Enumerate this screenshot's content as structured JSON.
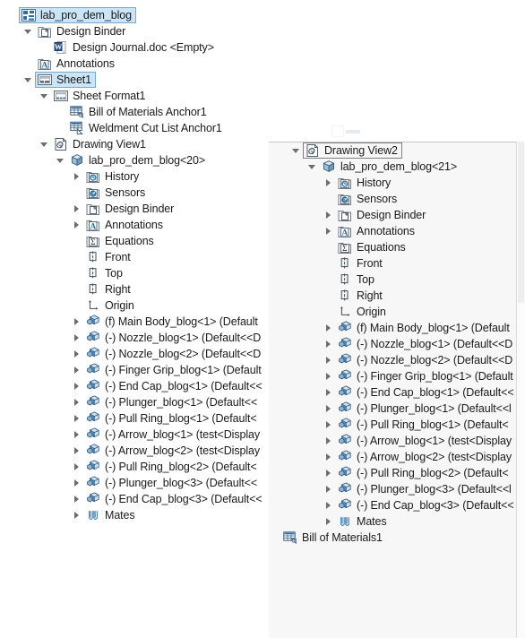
{
  "app": {
    "title": "SolidWorks Drawing FeatureManager Design Tree",
    "selection_color": "#cce4f7",
    "selection_border_color": "#7aa7cc",
    "focus_border_color": "#7d7d7d",
    "panel_background": "#f7f7f7",
    "text_color": "#1a1a1a"
  },
  "left_tree": {
    "panel_name": "drawing-feature-tree",
    "nodes": [
      {
        "label": "lab_pro_dem_blog",
        "icon": "drawing-document-icon",
        "depth": 0,
        "twisty": "none",
        "state": "selected"
      },
      {
        "label": "Design Binder",
        "icon": "design-binder-folder-icon",
        "depth": 1,
        "twisty": "expanded",
        "state": "normal"
      },
      {
        "label": "Design Journal.doc <Empty>",
        "icon": "word-document-icon",
        "depth": 2,
        "twisty": "none",
        "state": "normal"
      },
      {
        "label": "Annotations",
        "icon": "annotations-folder-icon",
        "depth": 1,
        "twisty": "none",
        "state": "normal"
      },
      {
        "label": "Sheet1",
        "icon": "sheet-icon",
        "depth": 1,
        "twisty": "expanded",
        "state": "selected"
      },
      {
        "label": "Sheet Format1",
        "icon": "sheet-format-icon",
        "depth": 2,
        "twisty": "expanded",
        "state": "normal"
      },
      {
        "label": "Bill of Materials Anchor1",
        "icon": "bom-anchor-icon",
        "depth": 3,
        "twisty": "none",
        "state": "normal"
      },
      {
        "label": "Weldment Cut List Anchor1",
        "icon": "weldment-cut-list-anchor-icon",
        "depth": 3,
        "twisty": "none",
        "state": "normal"
      },
      {
        "label": "Drawing View1",
        "icon": "drawing-view-icon",
        "depth": 2,
        "twisty": "expanded",
        "state": "normal"
      },
      {
        "label": "lab_pro_dem_blog<20>",
        "icon": "assembly-icon",
        "depth": 3,
        "twisty": "expanded",
        "state": "normal"
      },
      {
        "label": "History",
        "icon": "history-folder-icon",
        "depth": 4,
        "twisty": "collapsed",
        "state": "normal"
      },
      {
        "label": "Sensors",
        "icon": "sensors-folder-icon",
        "depth": 4,
        "twisty": "none",
        "state": "normal"
      },
      {
        "label": "Design Binder",
        "icon": "design-binder-folder-icon",
        "depth": 4,
        "twisty": "collapsed",
        "state": "normal"
      },
      {
        "label": "Annotations",
        "icon": "annotations-folder-icon",
        "depth": 4,
        "twisty": "collapsed",
        "state": "normal"
      },
      {
        "label": "Equations",
        "icon": "equations-folder-icon",
        "depth": 4,
        "twisty": "none",
        "state": "normal"
      },
      {
        "label": "Front",
        "icon": "plane-icon",
        "depth": 4,
        "twisty": "none",
        "state": "normal"
      },
      {
        "label": "Top",
        "icon": "plane-icon",
        "depth": 4,
        "twisty": "none",
        "state": "normal"
      },
      {
        "label": "Right",
        "icon": "plane-icon",
        "depth": 4,
        "twisty": "none",
        "state": "normal"
      },
      {
        "label": "Origin",
        "icon": "origin-icon",
        "depth": 4,
        "twisty": "none",
        "state": "normal"
      },
      {
        "label": "(f) Main Body_blog<1> (Default",
        "icon": "part-component-icon",
        "depth": 4,
        "twisty": "collapsed",
        "state": "normal"
      },
      {
        "label": "(-) Nozzle_blog<1> (Default<<D",
        "icon": "part-component-icon",
        "depth": 4,
        "twisty": "collapsed",
        "state": "normal"
      },
      {
        "label": "(-) Nozzle_blog<2> (Default<<D",
        "icon": "part-component-icon",
        "depth": 4,
        "twisty": "collapsed",
        "state": "normal"
      },
      {
        "label": "(-) Finger Grip_blog<1> (Default",
        "icon": "part-component-icon",
        "depth": 4,
        "twisty": "collapsed",
        "state": "normal"
      },
      {
        "label": "(-) End Cap_blog<1> (Default<<",
        "icon": "part-component-icon",
        "depth": 4,
        "twisty": "collapsed",
        "state": "normal"
      },
      {
        "label": "(-) Plunger_blog<1> (Default<<",
        "icon": "part-component-icon",
        "depth": 4,
        "twisty": "collapsed",
        "state": "normal"
      },
      {
        "label": "(-) Pull Ring_blog<1> (Default<",
        "icon": "part-component-icon",
        "depth": 4,
        "twisty": "collapsed",
        "state": "normal"
      },
      {
        "label": "(-) Arrow_blog<1> (test<Display",
        "icon": "part-component-icon",
        "depth": 4,
        "twisty": "collapsed",
        "state": "normal"
      },
      {
        "label": "(-) Arrow_blog<2> (test<Display",
        "icon": "part-component-icon",
        "depth": 4,
        "twisty": "collapsed",
        "state": "normal"
      },
      {
        "label": "(-) Pull Ring_blog<2> (Default<",
        "icon": "part-component-icon",
        "depth": 4,
        "twisty": "collapsed",
        "state": "normal"
      },
      {
        "label": "(-) Plunger_blog<3> (Default<<",
        "icon": "part-component-icon",
        "depth": 4,
        "twisty": "collapsed",
        "state": "normal"
      },
      {
        "label": "(-) End Cap_blog<3> (Default<<",
        "icon": "part-component-icon",
        "depth": 4,
        "twisty": "collapsed",
        "state": "normal"
      },
      {
        "label": "Mates",
        "icon": "mates-icon",
        "depth": 4,
        "twisty": "collapsed",
        "state": "normal"
      }
    ]
  },
  "right_tree": {
    "panel_name": "drawing-view2-feature-tree",
    "nodes": [
      {
        "label": "Drawing View2",
        "icon": "drawing-view-icon",
        "depth": 0,
        "twisty": "expanded",
        "state": "focused"
      },
      {
        "label": "lab_pro_dem_blog<21>",
        "icon": "assembly-icon",
        "depth": 1,
        "twisty": "expanded",
        "state": "normal"
      },
      {
        "label": "History",
        "icon": "history-folder-icon",
        "depth": 2,
        "twisty": "collapsed",
        "state": "normal"
      },
      {
        "label": "Sensors",
        "icon": "sensors-folder-icon",
        "depth": 2,
        "twisty": "none",
        "state": "normal"
      },
      {
        "label": "Design Binder",
        "icon": "design-binder-folder-icon",
        "depth": 2,
        "twisty": "collapsed",
        "state": "normal"
      },
      {
        "label": "Annotations",
        "icon": "annotations-folder-icon",
        "depth": 2,
        "twisty": "collapsed",
        "state": "normal"
      },
      {
        "label": "Equations",
        "icon": "equations-folder-icon",
        "depth": 2,
        "twisty": "none",
        "state": "normal"
      },
      {
        "label": "Front",
        "icon": "plane-icon",
        "depth": 2,
        "twisty": "none",
        "state": "normal"
      },
      {
        "label": "Top",
        "icon": "plane-icon",
        "depth": 2,
        "twisty": "none",
        "state": "normal"
      },
      {
        "label": "Right",
        "icon": "plane-icon",
        "depth": 2,
        "twisty": "none",
        "state": "normal"
      },
      {
        "label": "Origin",
        "icon": "origin-icon",
        "depth": 2,
        "twisty": "none",
        "state": "normal"
      },
      {
        "label": "(f) Main Body_blog<1> (Default",
        "icon": "part-component-icon",
        "depth": 2,
        "twisty": "collapsed",
        "state": "normal"
      },
      {
        "label": "(-) Nozzle_blog<1> (Default<<D",
        "icon": "part-component-icon",
        "depth": 2,
        "twisty": "collapsed",
        "state": "normal"
      },
      {
        "label": "(-) Nozzle_blog<2> (Default<<D",
        "icon": "part-component-icon",
        "depth": 2,
        "twisty": "collapsed",
        "state": "normal"
      },
      {
        "label": "(-) Finger Grip_blog<1> (Default",
        "icon": "part-component-icon",
        "depth": 2,
        "twisty": "collapsed",
        "state": "normal"
      },
      {
        "label": "(-) End Cap_blog<1> (Default<<",
        "icon": "part-component-icon",
        "depth": 2,
        "twisty": "collapsed",
        "state": "normal"
      },
      {
        "label": "(-) Plunger_blog<1> (Default<<l",
        "icon": "part-component-icon",
        "depth": 2,
        "twisty": "collapsed",
        "state": "normal"
      },
      {
        "label": "(-) Pull Ring_blog<1> (Default<",
        "icon": "part-component-icon",
        "depth": 2,
        "twisty": "collapsed",
        "state": "normal"
      },
      {
        "label": "(-) Arrow_blog<1> (test<Display",
        "icon": "part-component-icon",
        "depth": 2,
        "twisty": "collapsed",
        "state": "normal"
      },
      {
        "label": "(-) Arrow_blog<2> (test<Display",
        "icon": "part-component-icon",
        "depth": 2,
        "twisty": "collapsed",
        "state": "normal"
      },
      {
        "label": "(-) Pull Ring_blog<2> (Default<",
        "icon": "part-component-icon",
        "depth": 2,
        "twisty": "collapsed",
        "state": "normal"
      },
      {
        "label": "(-) Plunger_blog<3> (Default<<l",
        "icon": "part-component-icon",
        "depth": 2,
        "twisty": "collapsed",
        "state": "normal"
      },
      {
        "label": "(-) End Cap_blog<3> (Default<<",
        "icon": "part-component-icon",
        "depth": 2,
        "twisty": "collapsed",
        "state": "normal"
      },
      {
        "label": "Mates",
        "icon": "mates-icon",
        "depth": 2,
        "twisty": "collapsed",
        "state": "normal"
      },
      {
        "label": "Bill of Materials1",
        "icon": "bom-anchor-icon",
        "depth": -1,
        "twisty": "none",
        "state": "normal"
      }
    ]
  }
}
